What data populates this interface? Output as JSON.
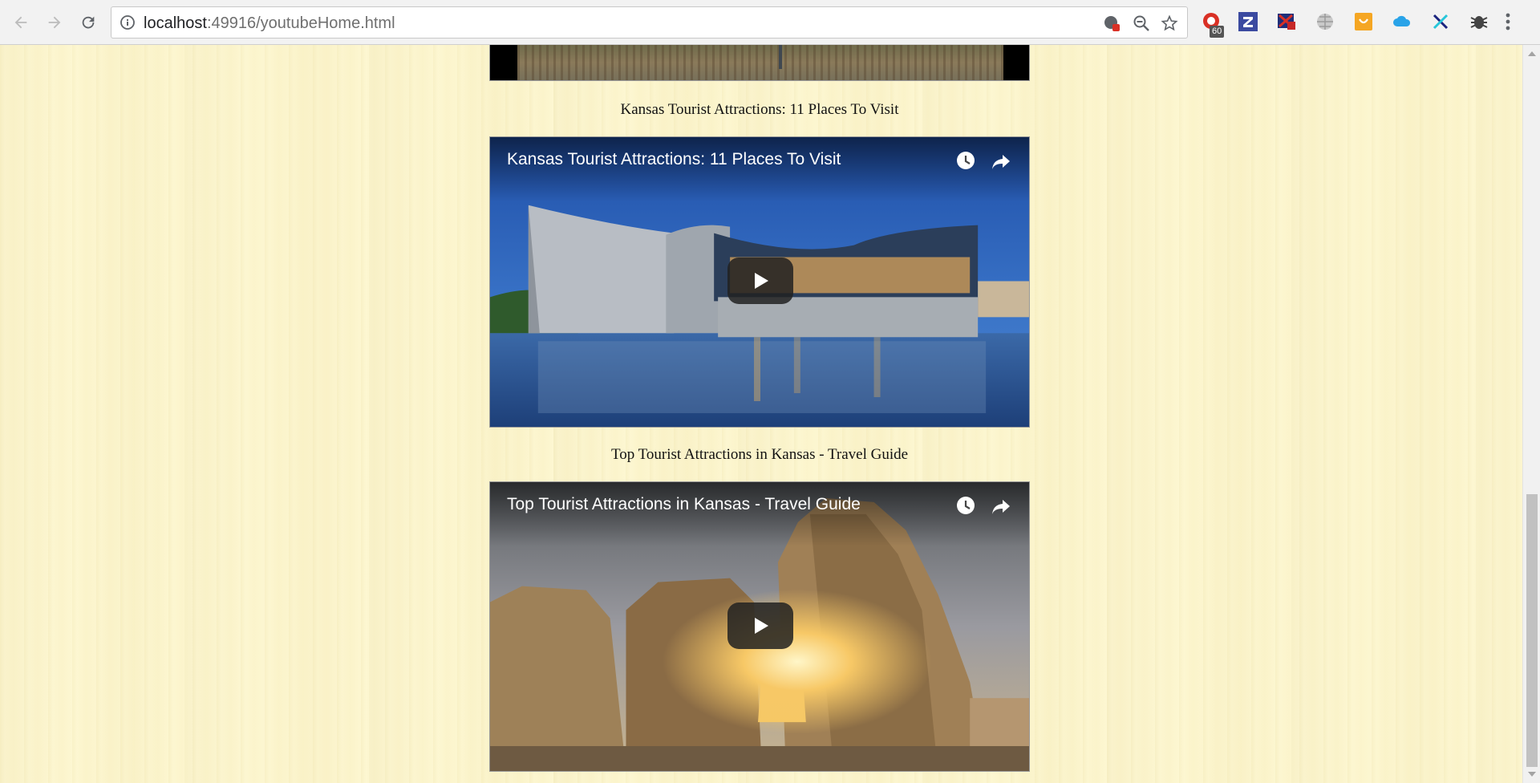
{
  "browser": {
    "url_host": "localhost",
    "url_path": ":49916/youtubeHome.html",
    "extension_badge": "60"
  },
  "videos": [
    {
      "caption": "Kansas Tourist Attractions: 11 Places To Visit",
      "title": "Kansas Tourist Attractions: 11 Places To Visit"
    },
    {
      "caption": "Top Tourist Attractions in Kansas - Travel Guide",
      "title": "Top Tourist Attractions in Kansas - Travel Guide"
    }
  ],
  "colors": {
    "page_background": "#fdf7d2",
    "toolbar_background": "#f2f2f2"
  },
  "icons": [
    "back-icon",
    "forward-icon",
    "reload-icon",
    "info-icon",
    "zoom-out-icon",
    "star-icon",
    "watch-later-icon",
    "share-icon",
    "play-icon"
  ]
}
